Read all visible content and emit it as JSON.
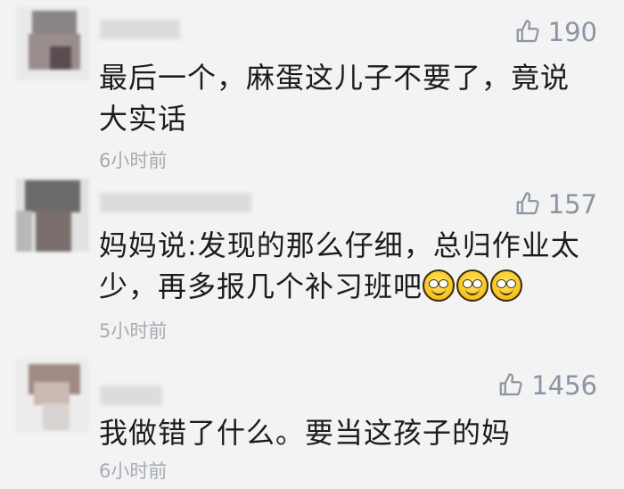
{
  "comments": [
    {
      "likes": "190",
      "text": "最后一个，麻蛋这儿子不要了，竟说大实话",
      "time": "6小时前",
      "emoji_count": 0
    },
    {
      "likes": "157",
      "text": "妈妈说:发现的那么仔细，总归作业太少，再多报几个补习班吧",
      "time": "5小时前",
      "emoji_count": 3
    },
    {
      "likes": "1456",
      "text": "我做错了什么。要当这孩子的妈",
      "time": "6小时前",
      "emoji_count": 0
    }
  ],
  "icons": {
    "like": "thumbs-up-icon",
    "emoji": "grinning-face-icon"
  },
  "colors": {
    "text": "#1c1c1c",
    "meta": "#a6abb3",
    "like": "#8a96a3"
  }
}
